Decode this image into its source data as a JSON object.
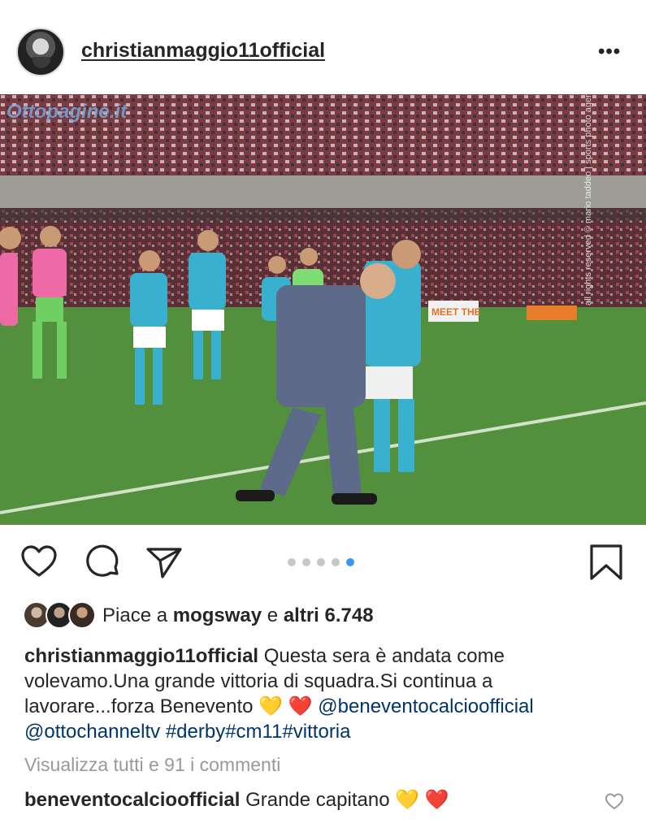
{
  "post": {
    "username": "christianmaggio11official",
    "more_label": "•••"
  },
  "photo": {
    "watermark": "Ottopagine.it",
    "credit": "all rights reserved © mario taddeo | sports photo agency",
    "banner": "MEET THE"
  },
  "actions": {
    "icons": [
      "heart-icon",
      "comment-icon",
      "share-icon",
      "bookmark-icon"
    ],
    "carousel": {
      "count": 5,
      "active_index": 4
    }
  },
  "likes": {
    "prefix": "Piace a",
    "user": "mogsway",
    "joiner": "e",
    "others": "altri 6.748"
  },
  "caption": {
    "username": "christianmaggio11official",
    "text": "Questa sera è andata come volevamo.Una grande vittoria di squadra.Si continua a lavorare...forza Benevento",
    "emoji_yellow_heart": "💛",
    "emoji_red_heart": "❤️",
    "mention_1": "@beneventocalcioofficial",
    "mention_2": "@ottochanneltv",
    "hashtags": "#derby#cm11#vittoria"
  },
  "view_all_comments": "Visualizza tutti e 91 i commenti",
  "comment": {
    "username": "beneventocalcioofficial",
    "text": "Grande capitano",
    "emoji_yellow_heart": "💛",
    "emoji_red_heart": "❤️"
  },
  "colors": {
    "link": "#003569",
    "carousel_active": "#3897f0",
    "muted": "#999999",
    "pitch": "#4f8a3a",
    "kit": "#3ab0cf"
  }
}
